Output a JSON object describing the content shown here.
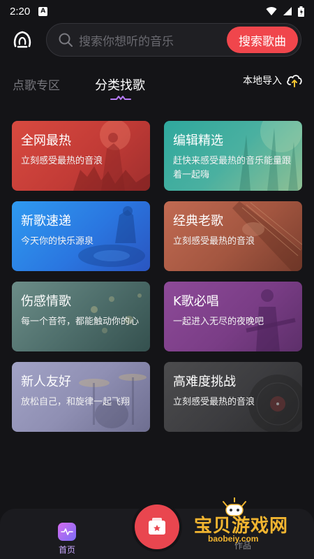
{
  "status_bar": {
    "time": "2:20",
    "badge": "A"
  },
  "search": {
    "placeholder": "搜索你想听的音乐",
    "button_label": "搜索歌曲"
  },
  "tabs": [
    {
      "label": "点歌专区",
      "active": false
    },
    {
      "label": "分类找歌",
      "active": true
    }
  ],
  "import": {
    "label": "本地导入"
  },
  "categories": [
    {
      "title": "全网最热",
      "subtitle": "立刻感受最热的音浪",
      "color": "#d84a40"
    },
    {
      "title": "编辑精选",
      "subtitle": "赶快来感受最热的音乐能量跟着一起嗨",
      "color": "#2fa89d"
    },
    {
      "title": "新歌速递",
      "subtitle": "今天你的快乐源泉",
      "color": "#2f9af0"
    },
    {
      "title": "经典老歌",
      "subtitle": "立刻感受最热的音浪",
      "color": "#c16a52"
    },
    {
      "title": "伤感情歌",
      "subtitle": "每一个音符，都能触动你的心",
      "color": "#6c8d88"
    },
    {
      "title": "K歌必唱",
      "subtitle": "一起进入无尽的夜晚吧",
      "color": "#8d4a98"
    },
    {
      "title": "新人友好",
      "subtitle": "放松自己，和旋律一起飞翔",
      "color": "#a2a3c6"
    },
    {
      "title": "高难度挑战",
      "subtitle": "立刻感受最热的音浪",
      "color": "#4c4c4e"
    }
  ],
  "bottom_nav": {
    "home_label": "首页",
    "profile_label": "作品"
  },
  "watermark": {
    "text": "宝贝游戏网",
    "url": "baobeiy.com"
  },
  "colors": {
    "accent": "#f0464c",
    "background": "#141417"
  }
}
